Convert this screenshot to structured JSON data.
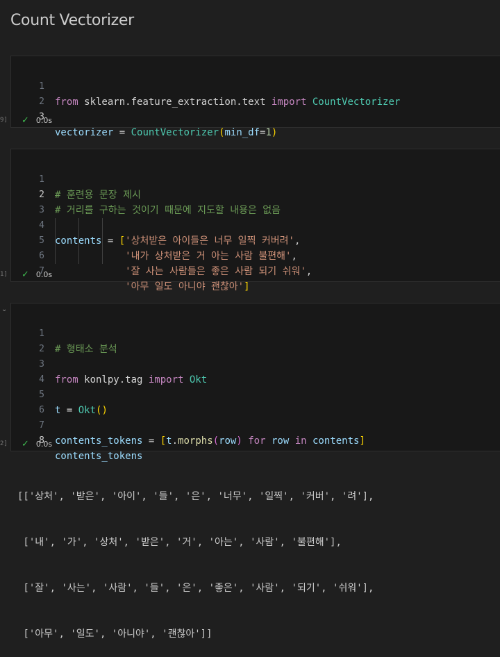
{
  "heading": "Count Vectorizer",
  "cells": [
    {
      "exec_count": "9]",
      "status_time": "0.0s",
      "lines": [
        {
          "num": "1",
          "text": "from sklearn.feature_extraction.text import CountVectorizer"
        },
        {
          "num": "2",
          "text": ""
        },
        {
          "num": "3",
          "text": "vectorizer = CountVectorizer(min_df=1)"
        }
      ]
    },
    {
      "exec_count": "1]",
      "status_time": "0.0s",
      "lines": [
        {
          "num": "1",
          "text": "# 훈련용 문장 제시"
        },
        {
          "num": "2",
          "text": "# 거리를 구하는 것이기 때문에 지도할 내용은 없음"
        },
        {
          "num": "3",
          "text": ""
        },
        {
          "num": "4",
          "text": "contents = ['상처받은 아이들은 너무 일찍 커버려',"
        },
        {
          "num": "5",
          "text": "            '내가 상처받은 거 아는 사람 불편해',"
        },
        {
          "num": "6",
          "text": "            '잘 사는 사람들은 좋은 사람 되기 쉬워',"
        },
        {
          "num": "7",
          "text": "            '아무 일도 아니야 괜찮아']"
        }
      ]
    },
    {
      "exec_count": "2]",
      "status_time": "0.0s",
      "lines": [
        {
          "num": "1",
          "text": "# 형태소 분석"
        },
        {
          "num": "2",
          "text": ""
        },
        {
          "num": "3",
          "text": "from konlpy.tag import Okt"
        },
        {
          "num": "4",
          "text": ""
        },
        {
          "num": "5",
          "text": "t = Okt()"
        },
        {
          "num": "6",
          "text": ""
        },
        {
          "num": "7",
          "text": "contents_tokens = [t.morphs(row) for row in contents]"
        },
        {
          "num": "8",
          "text": "contents_tokens"
        }
      ]
    }
  ],
  "output_lines": [
    "[['상처', '받은', '아이', '들', '은', '너무', '일찍', '커버', '려'],",
    " ['내', '가', '상처', '받은', '거', '아는', '사람', '불편해'],",
    " ['잘', '사는', '사람', '들', '은', '좋은', '사람', '되기', '쉬워'],",
    " ['아무', '일도', '아니야', '괜찮아']]"
  ],
  "icons": {
    "success": "check-icon",
    "collapse": "chevron-down-icon"
  },
  "colors": {
    "background": "#1f1f1f",
    "cell": "#181818",
    "success": "#3fb950"
  }
}
